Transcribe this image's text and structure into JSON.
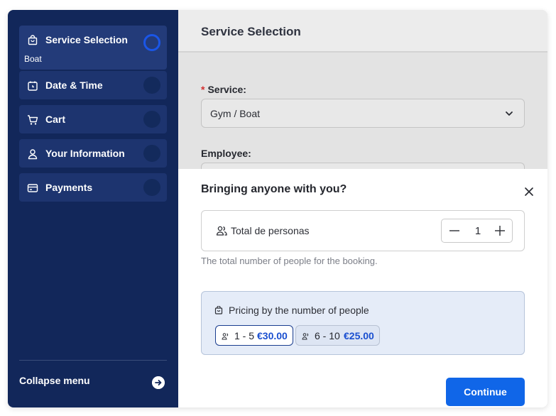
{
  "sidebar": {
    "steps": [
      {
        "label": "Service Selection",
        "sub": "Boat",
        "icon": "shopping-bag-icon",
        "active": true
      },
      {
        "label": "Date & Time",
        "icon": "calendar-clock-icon",
        "active": false
      },
      {
        "label": "Cart",
        "icon": "cart-icon",
        "active": false
      },
      {
        "label": "Your Information",
        "icon": "user-icon",
        "active": false
      },
      {
        "label": "Payments",
        "icon": "credit-card-icon",
        "active": false
      }
    ],
    "collapse_label": "Collapse menu",
    "collapse_icon": "arrow-right-circle-icon"
  },
  "main": {
    "title": "Service Selection",
    "service_required_mark": "*",
    "service_label": "Service:",
    "service_value": "Gym / Boat",
    "employee_label": "Employee:"
  },
  "modal": {
    "title": "Bringing anyone with you?",
    "people_label": "Total de personas",
    "people_value": "1",
    "helper": "The total number of people for the booking.",
    "pricing_title": "Pricing by the number of people",
    "tiers": [
      {
        "range": "1 - 5",
        "price": "€30.00",
        "selected": true
      },
      {
        "range": "6 - 10",
        "price": "€25.00",
        "selected": false
      }
    ],
    "continue_label": "Continue"
  },
  "colors": {
    "sidebar_bg": "#12275a",
    "accent": "#1066e8",
    "price": "#1a4fd0",
    "required": "#d32f2f"
  }
}
